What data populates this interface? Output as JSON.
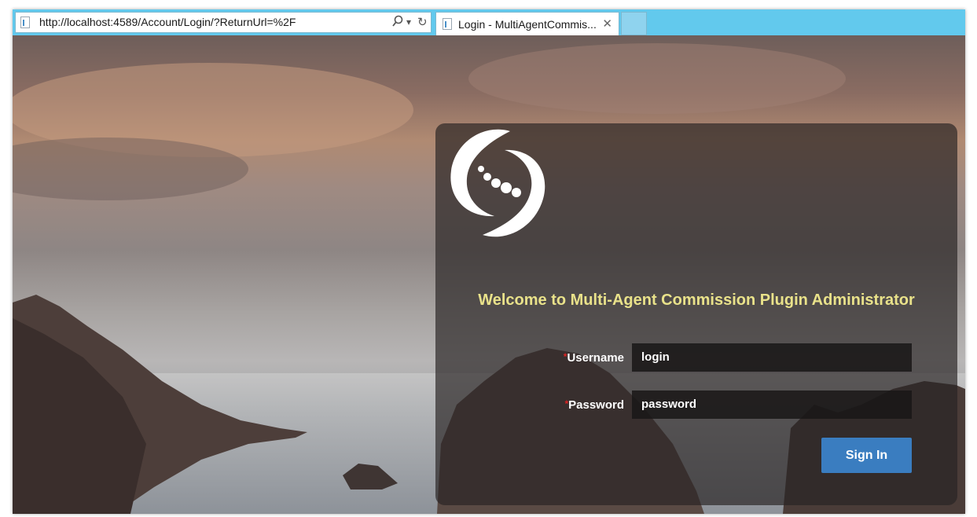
{
  "browser": {
    "address": "http://localhost:4589/Account/Login/?ReturnUrl=%2F",
    "search_icon": "search-icon",
    "dropdown_glyph": "▾",
    "refresh_glyph": "↻",
    "tab_title": "Login - MultiAgentCommis...",
    "tab_close": "✕"
  },
  "login": {
    "welcome": "Welcome to Multi-Agent Commission Plugin Administrator",
    "required_mark": "*",
    "username_label": "Username",
    "username_value": "login",
    "password_label": "Password",
    "password_value": "password",
    "signin_label": "Sign In"
  },
  "colors": {
    "browser_chrome": "#62c9ed",
    "welcome_text": "#e9e28a",
    "signin_button": "#3a7dc0",
    "required": "#dd2222"
  }
}
